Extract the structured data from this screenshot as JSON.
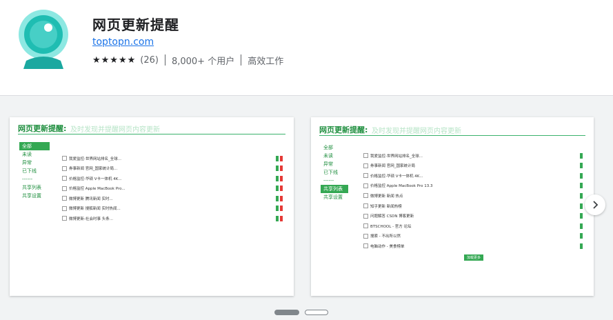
{
  "extension": {
    "name": "网页更新提醒",
    "site": "toptopn.com",
    "stars": "★★★★★",
    "rating_count": "(26)",
    "users": "8,000+ 个用户",
    "category": "高效工作"
  },
  "screenshots": [
    {
      "title": "网页更新提醒:",
      "subtitle": "及时发现并提醒网页内容更新",
      "sidebar": [
        "全部",
        "未读",
        "异常",
        "已下线",
        "------",
        "共享列表",
        "共享设置"
      ],
      "active_index": 0,
      "rows": [
        "我爱监控-世界网站排名_全球...",
        "券事新闻 官网_国家统计局...",
        "价格监控-华硕 V卡一体机 4K...",
        "价格监控 Apple MacBook Pro...",
        "微博更新 腾讯新闻 实时...",
        "微博更新 搜狐新闻 实时热闻...",
        "微博更新-社会时事 头条..."
      ]
    },
    {
      "title": "网页更新提醒:",
      "subtitle": "及时发现并提醒网页内容更新",
      "sidebar": [
        "全部",
        "未读",
        "异常",
        "已下线",
        "------",
        "共享列表",
        "共享设置"
      ],
      "active_index": 5,
      "rows": [
        "我爱监控-世界网站排名_全球...",
        "券事新闻 官网_国家统计局",
        "价格监控-华硕 V卡一体机 4K...",
        "价格监控 Apple MacBook Pro 13.3",
        "微博更新 新闻 热点",
        "知乎更新 新闻热榜",
        "问题解答 CSDN 博客更新",
        "BTSCHOOL - 官方 论坛",
        "搜索 - 不出所以然",
        "电脑动作 - 美食榜单"
      ],
      "load_more": "加载更多"
    }
  ],
  "colors": {
    "green": "#34a853",
    "red": "#e53935",
    "link": "#1a73e8"
  }
}
